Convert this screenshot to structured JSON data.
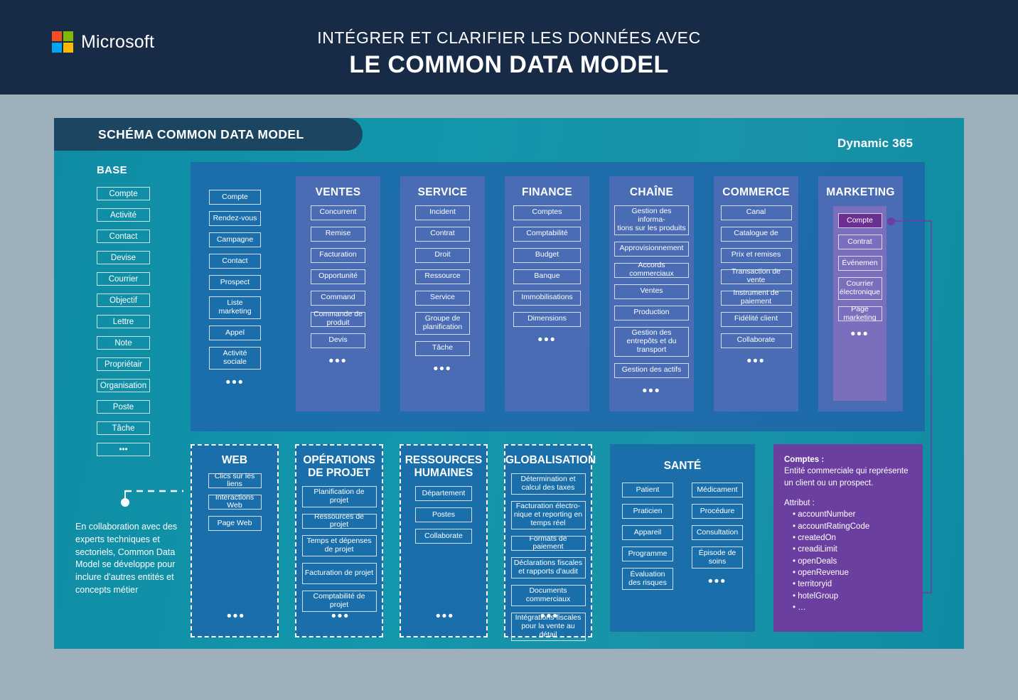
{
  "header": {
    "brand": "Microsoft",
    "subtitle": "INTÉGRER ET CLARIFIER LES DONNÉES AVEC",
    "title": "LE COMMON DATA MODEL"
  },
  "panel": {
    "schema_label": "SCHÉMA COMMON DATA MODEL",
    "dynamics_label": "Dynamic 365"
  },
  "base": {
    "title": "BASE",
    "items": [
      "Compte",
      "Activité",
      "Contact",
      "Devise",
      "Courrier",
      "Objectif",
      "Lettre",
      "Note",
      "Propriétair",
      "Organisation",
      "Poste",
      "Tâche",
      "•••"
    ]
  },
  "col2": {
    "items": [
      "Compte",
      "Rendez-vous",
      "Campagne",
      "Contact",
      "Prospect",
      "Liste marketing",
      "Appel",
      "Activité sociale"
    ],
    "more": "•••"
  },
  "columns": [
    {
      "title": "VENTES",
      "items": [
        "Concurrent",
        "Remise",
        "Facturation",
        "Opportunité",
        "Command",
        "Commande de produit",
        "Devis"
      ],
      "more": "•••"
    },
    {
      "title": "SERVICE",
      "items": [
        "Incident",
        "Contrat",
        "Droit",
        "Ressource",
        "Service",
        "Groupe de planification",
        "Tâche"
      ],
      "more": "•••"
    },
    {
      "title": "FINANCE",
      "items": [
        "Comptes",
        "Comptabilité",
        "Budget",
        "Banque",
        "Immobilisations",
        "Dimensions"
      ],
      "more": "•••"
    },
    {
      "title": "CHAÎNE",
      "items": [
        "Gestion des informa-tions sur les produits",
        "Approvisionnement",
        "Accords commerciaux",
        "Ventes",
        "Production",
        "Gestion des entrepôts et du transport",
        "Gestion des actifs"
      ],
      "more": "•••"
    },
    {
      "title": "COMMERCE",
      "items": [
        "Canal",
        "Catalogue de",
        "Prix et remises",
        "Transaction de vente",
        "Instrument de paiement",
        "Fidélité client",
        "Collaborate"
      ],
      "more": "•••"
    },
    {
      "title": "MARKETING",
      "items": [
        "Compte",
        "Contrat",
        "Événemen",
        "Courrier électronique",
        "Page marketing"
      ],
      "more": "•••",
      "selected": "Compte"
    }
  ],
  "bottom": [
    {
      "title": "WEB",
      "items": [
        "Clics sur les liens",
        "Interactions Web",
        "Page Web"
      ],
      "more": "•••"
    },
    {
      "title": "OPÉRATIONS DE PROJET",
      "items": [
        "Planification de projet",
        "Ressources de projet",
        "Temps et dépenses de projet",
        "Facturation de projet",
        "Comptabilité de projet"
      ],
      "more": "•••"
    },
    {
      "title": "RESSOURCES HUMAINES",
      "items": [
        "Département",
        "Postes",
        "Collaborate"
      ],
      "more": "•••"
    },
    {
      "title": "GLOBALISATION",
      "items": [
        "Détermination et calcul des taxes",
        "Facturation électro-nique et reporting en temps réel",
        "Formats de paiement",
        "Déclarations fiscales et rapports d'audit",
        "Documents commerciaux",
        "Intégrations fiscales pour la vente au détail"
      ],
      "more": "•••"
    }
  ],
  "sante": {
    "title": "SANTÉ",
    "left_items": [
      "Patient",
      "Praticien",
      "Appareil",
      "Programme",
      "Évaluation des risques"
    ],
    "right_items": [
      "Médicament",
      "Procédure",
      "Consultation",
      "Épisode de soins"
    ],
    "more": "•••"
  },
  "info_panel": {
    "entity_label": "Comptes :",
    "description": "Entité commerciale qui représente un client ou un prospect.",
    "attribute_label": "Attribut :",
    "attributes": [
      "accountNumber",
      "accountRatingCode",
      "createdOn",
      "creadiLimit",
      "openDeals",
      "openRevenue",
      "territoryid",
      "hotelGroup",
      "…"
    ]
  },
  "left_note": {
    "text": "En collaboration avec des experts techniques et sectoriels, Common Data Model se développe pour inclure d'autres entités et concepts métier"
  },
  "colors": {
    "header_bg": "#172a46",
    "page_bg": "#9fb0bd",
    "teal": "#1396ac",
    "blue_container": "#1d6aa8",
    "card_blue": "#4a6cb5",
    "purple": "#6b3fa0",
    "purple_light": "#7a6fbd",
    "purple_selected": "#6b2f92",
    "pill": "#1b4560"
  }
}
